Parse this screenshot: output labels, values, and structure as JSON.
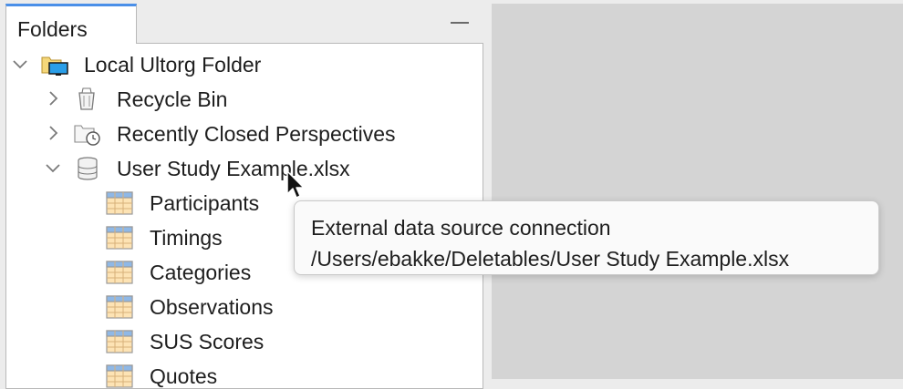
{
  "panel": {
    "tab_label": "Folders"
  },
  "tree": {
    "root": {
      "label": "Local Ultorg Folder",
      "icon": "folder-computer-icon",
      "expanded": true
    },
    "recycle_bin": {
      "label": "Recycle Bin",
      "icon": "recycle-bin-icon",
      "expanded": false
    },
    "recent": {
      "label": "Recently Closed Perspectives",
      "icon": "folder-clock-icon",
      "expanded": false
    },
    "datasource": {
      "label": "User Study Example.xlsx",
      "icon": "database-icon",
      "expanded": true
    },
    "tables": [
      {
        "label": "Participants"
      },
      {
        "label": "Timings"
      },
      {
        "label": "Categories"
      },
      {
        "label": "Observations"
      },
      {
        "label": "SUS Scores"
      },
      {
        "label": "Quotes"
      }
    ]
  },
  "tooltip": {
    "line1": "External data source connection",
    "line2": "/Users/ebakke/Deletables/User Study Example.xlsx"
  },
  "colors": {
    "tab_accent": "#4a8fe8",
    "editor_background": "#d4d4d4"
  }
}
